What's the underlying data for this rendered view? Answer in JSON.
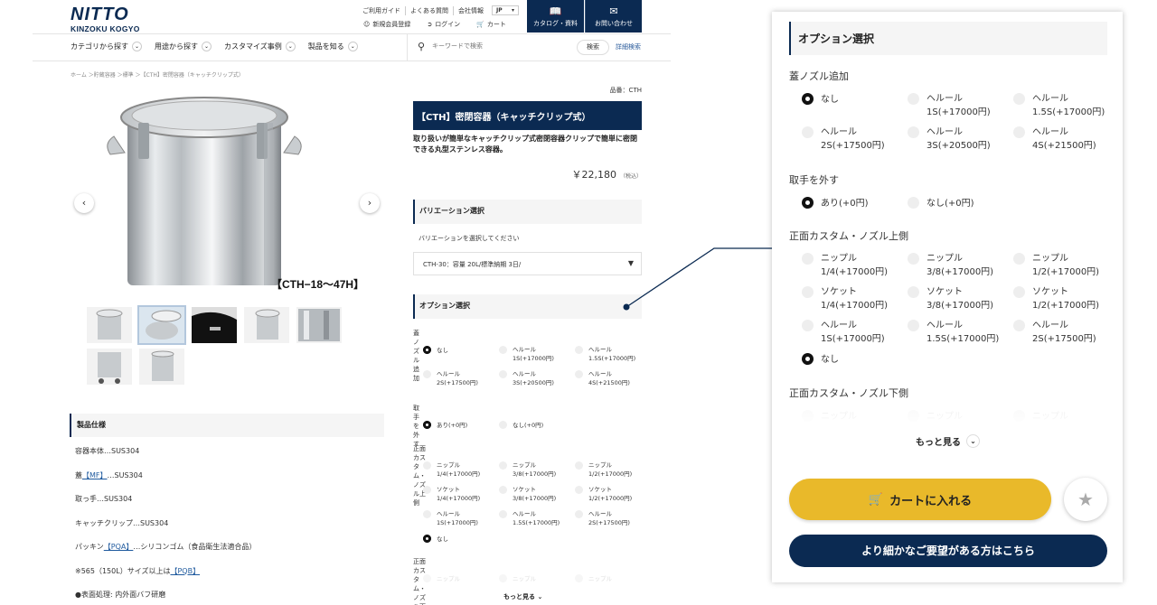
{
  "header": {
    "logo_main": "NITTO",
    "logo_sub": "KINZOKU KOGYO",
    "util_links": [
      "ご利用ガイド",
      "よくある質問",
      "会社情報"
    ],
    "lang": "JP",
    "member_signup": "新規会員登録",
    "login": "ログイン",
    "cart": "カート",
    "catalog_btn": "カタログ・資料",
    "contact_btn": "お問い合わせ"
  },
  "nav": {
    "items": [
      "カテゴリから探す",
      "用途から探す",
      "カスタマイズ事例",
      "製品を知る"
    ],
    "search_placeholder": "キーワードで検索",
    "search_btn": "検索",
    "advanced": "詳細検索"
  },
  "breadcrumb": "ホーム ＞貯蔵容器 ＞標準 ＞【CTH】密閉容器（キャッチクリップ式）",
  "gallery": {
    "caption": "【CTH−18〜47H】"
  },
  "specs": {
    "heading": "製品仕様",
    "lines": [
      {
        "pre": "容器本体…SUS304",
        "link": "",
        "post": ""
      },
      {
        "pre": "蓋",
        "link": "【MF】",
        "post": "…SUS304"
      },
      {
        "pre": "取っ手…SUS304",
        "link": "",
        "post": ""
      },
      {
        "pre": "キャッチクリップ…SUS304",
        "link": "",
        "post": ""
      },
      {
        "pre": "パッキン",
        "link": "【PQA】",
        "post": "…シリコンゴム（食品衛生法適合品）"
      },
      {
        "pre": "※565（150L）サイズ以上は",
        "link": "【PQB】",
        "post": ""
      },
      {
        "pre": "●表面処理: 内外面バフ研磨",
        "link": "",
        "post": ""
      }
    ]
  },
  "product": {
    "sku": "品番：CTH",
    "title": "【CTH】密閉容器（キャッチクリップ式）",
    "desc": "取り扱いが簡単なキャッチクリップ式密閉容器クリップで簡単に密閉できる丸型ステンレス容器。",
    "price": "￥22,180",
    "tax_note": "（税込）"
  },
  "variation": {
    "heading": "バリエーション選択",
    "hint": "バリエーションを選択してください",
    "selected": "CTH-30：容量 20L/標準納期 3日/"
  },
  "options": {
    "heading": "オプション選択",
    "more": "もっと見る",
    "groups": [
      {
        "title": "蓋ノズル追加",
        "opts": [
          {
            "l1": "なし",
            "l2": "",
            "on": true
          },
          {
            "l1": "ヘルール",
            "l2": "1S(+17000円)",
            "on": false
          },
          {
            "l1": "ヘルール",
            "l2": "1.5S(+17000円)",
            "on": false
          },
          {
            "l1": "ヘルール",
            "l2": "2S(+17500円)",
            "on": false
          },
          {
            "l1": "ヘルール",
            "l2": "3S(+20500円)",
            "on": false
          },
          {
            "l1": "ヘルール",
            "l2": "4S(+21500円)",
            "on": false
          }
        ]
      },
      {
        "title": "取手を外す",
        "opts": [
          {
            "l1": "あり(+0円)",
            "l2": "",
            "on": true
          },
          {
            "l1": "なし(+0円)",
            "l2": "",
            "on": false
          }
        ]
      },
      {
        "title": "正面カスタム・ノズル上側",
        "opts": [
          {
            "l1": "ニップル",
            "l2": "1/4(+17000円)",
            "on": false
          },
          {
            "l1": "ニップル",
            "l2": "3/8(+17000円)",
            "on": false
          },
          {
            "l1": "ニップル",
            "l2": "1/2(+17000円)",
            "on": false
          },
          {
            "l1": "ソケット",
            "l2": "1/4(+17000円)",
            "on": false
          },
          {
            "l1": "ソケット",
            "l2": "3/8(+17000円)",
            "on": false
          },
          {
            "l1": "ソケット",
            "l2": "1/2(+17000円)",
            "on": false
          },
          {
            "l1": "ヘルール",
            "l2": "1S(+17000円)",
            "on": false
          },
          {
            "l1": "ヘルール",
            "l2": "1.5S(+17000円)",
            "on": false
          },
          {
            "l1": "ヘルール",
            "l2": "2S(+17500円)",
            "on": false
          },
          {
            "l1": "なし",
            "l2": "",
            "on": true
          }
        ]
      },
      {
        "title": "正面カスタム・ノズル下側",
        "opts": [
          {
            "l1": "ニップル",
            "l2": "",
            "on": false
          },
          {
            "l1": "ニップル",
            "l2": "",
            "on": false
          },
          {
            "l1": "ニップル",
            "l2": "",
            "on": false
          }
        ]
      }
    ]
  },
  "actions": {
    "cart": "カートに入れる",
    "request": "より細かなご要望がある方はこちら"
  },
  "colors": {
    "navy": "#0b2a52",
    "cart_yellow": "#e9b92a"
  }
}
